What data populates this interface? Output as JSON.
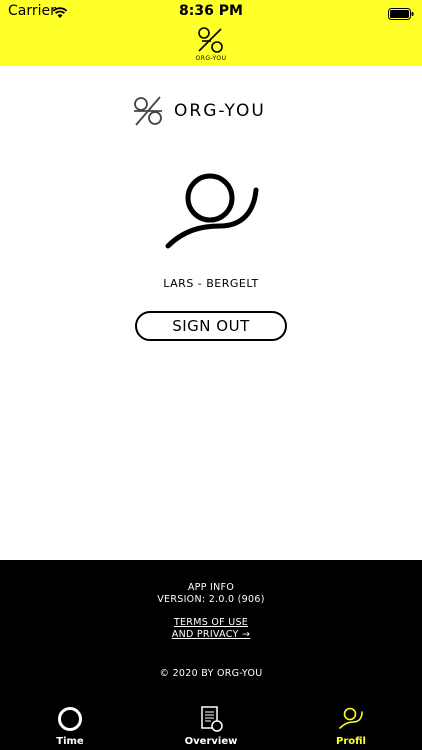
{
  "status_bar": {
    "carrier": "Carrier",
    "time": "8:36 PM"
  },
  "header": {
    "logo_text": "ORG-YOU"
  },
  "brand": {
    "name": "ORG-YOU"
  },
  "profile": {
    "username": "LARS - BERGELT",
    "sign_out_label": "SIGN OUT"
  },
  "footer": {
    "app_info": "APP INFO",
    "version": "VERSION: 2.0.0 (906)",
    "terms_line1": "TERMS OF USE",
    "terms_line2": "AND PRIVACY →",
    "copyright": "© 2020 BY ORG-YOU"
  },
  "tabs": [
    {
      "label": "Time",
      "icon": "circle-icon"
    },
    {
      "label": "Overview",
      "icon": "document-icon"
    },
    {
      "label": "Profil",
      "icon": "profile-icon",
      "active": true
    }
  ],
  "colors": {
    "accent": "#ffff2a",
    "footer_bg": "#000000"
  }
}
